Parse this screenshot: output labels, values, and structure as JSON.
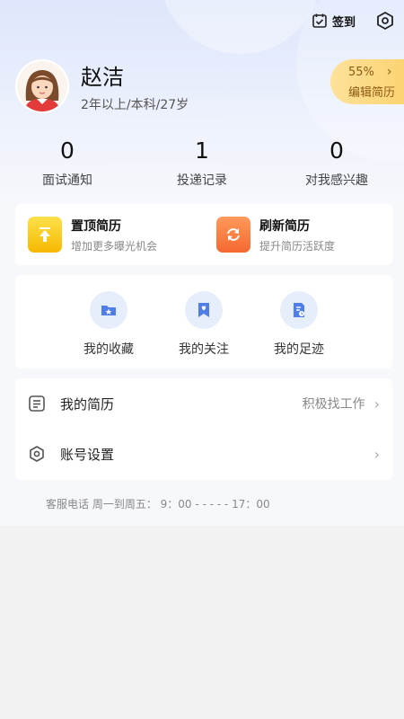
{
  "header": {
    "checkin_label": "签到",
    "icons": [
      "calendar-check-icon",
      "settings-gear-icon"
    ]
  },
  "profile": {
    "name": "赵洁",
    "info": "2年以上/本科/27岁",
    "resume_completion": "55%",
    "resume_edit_label": "编辑简历"
  },
  "stats": [
    {
      "value": "0",
      "label": "面试通知"
    },
    {
      "value": "1",
      "label": "投递记录"
    },
    {
      "value": "0",
      "label": "对我感兴趣"
    }
  ],
  "promos": [
    {
      "title": "置顶简历",
      "subtitle": "增加更多曝光机会",
      "icon": "pin-top-icon"
    },
    {
      "title": "刷新简历",
      "subtitle": "提升简历活跃度",
      "icon": "refresh-icon"
    }
  ],
  "quick_links": [
    {
      "label": "我的收藏",
      "icon": "favorites-folder-icon"
    },
    {
      "label": "我的关注",
      "icon": "follow-bookmark-icon"
    },
    {
      "label": "我的足迹",
      "icon": "history-document-icon"
    }
  ],
  "menu": [
    {
      "label": "我的简历",
      "status": "积极找工作",
      "icon": "resume-list-icon"
    },
    {
      "label": "账号设置",
      "status": "",
      "icon": "settings-hexagon-icon"
    }
  ],
  "footer": {
    "service_text": "客服电话 周一到周五：  9：00 - - - - - 17：00"
  },
  "colors": {
    "accent_blue": "#4f7ee8",
    "pill_yellow": "#fbd06a",
    "pin_yellow": "#f6b800",
    "refresh_orange": "#f46830"
  }
}
